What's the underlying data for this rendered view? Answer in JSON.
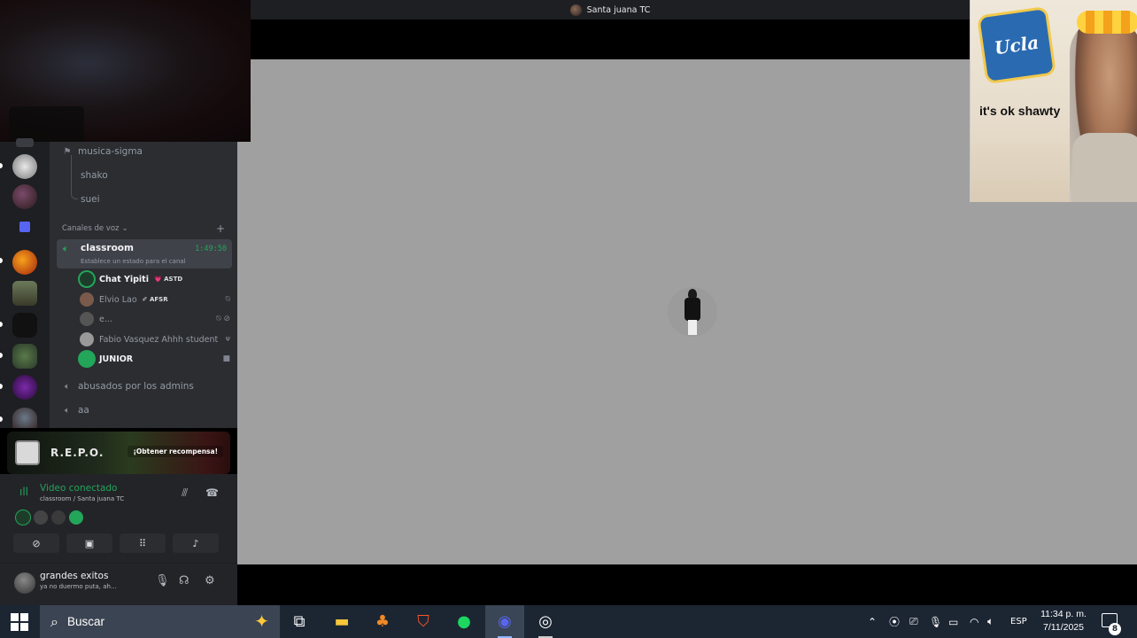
{
  "window": {
    "title": "Santa juana TC"
  },
  "meme": {
    "caption": "it's ok shawty",
    "logo_text": "Ucla"
  },
  "channels": {
    "text_channel": "musica-sigma",
    "threads": [
      "shako",
      "suei"
    ],
    "category": "Canales de voz",
    "active_voice": {
      "name": "classroom",
      "timer": "1:49:50",
      "status_hint": "Establece un estado para el canal"
    },
    "voice_users": [
      {
        "name": "Chat Yipiti",
        "tag": "ASTD",
        "bold": true
      },
      {
        "name": "Elvio Lao",
        "tag": "AFSR",
        "bold": false
      },
      {
        "name": "e...",
        "tag": "",
        "bold": false
      },
      {
        "name": "Fabio Vasquez Ahhh student",
        "tag": "",
        "bold": false
      },
      {
        "name": "JUNIOR",
        "tag": "",
        "bold": true
      }
    ],
    "other_voice": [
      "abusados por los admins",
      "aa"
    ]
  },
  "banner": {
    "logo": "R.E.P.O.",
    "cta": "¡Obtener recompensa!"
  },
  "voice_panel": {
    "title": "Video conectado",
    "subtitle": "classroom / Santa juana TC"
  },
  "user_panel": {
    "name": "grandes exitos",
    "status": "ya no duermo puta, ah..."
  },
  "taskbar": {
    "search_placeholder": "Buscar",
    "lang": "ESP",
    "time": "11:34 p. m.",
    "date": "7/11/2025",
    "notifications": "8"
  },
  "colors": {
    "discord_green": "#23a55a",
    "stage_bg": "#a0a0a0",
    "taskbar_bg": "#1c2633"
  }
}
